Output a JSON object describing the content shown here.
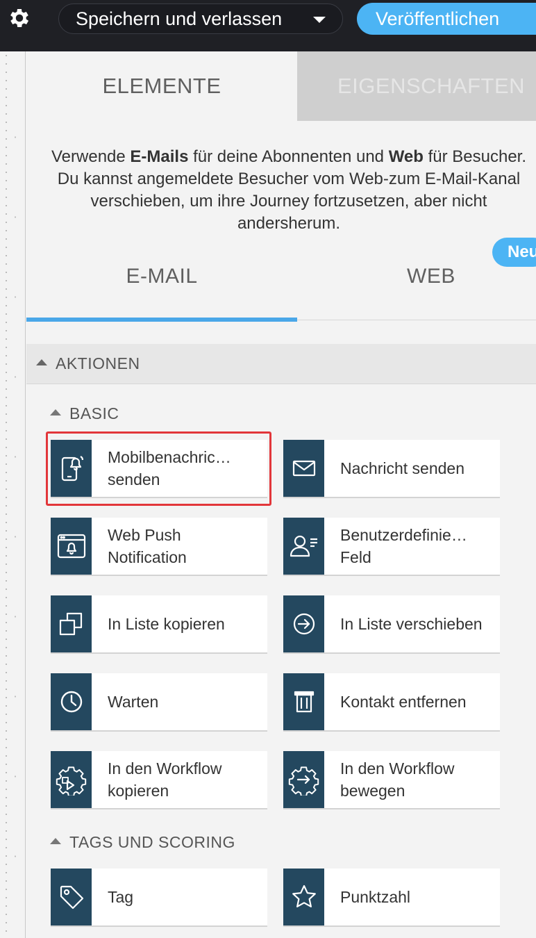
{
  "topbar": {
    "settings_icon": "gear-icon",
    "save_label": "Speichern und verlassen",
    "publish_label": "Veröffentlichen"
  },
  "panel_tabs": {
    "elements": "ELEMENTE",
    "properties": "EIGENSCHAFTEN"
  },
  "description": {
    "part1": "Verwende ",
    "bold1": "E-Mails",
    "part2": " für deine Abonnenten und ",
    "bold2": "Web",
    "part3": " für Besucher. Du kannst angemeldete Besucher vom Web-zum E-Mail-Kanal verschieben, um ihre Journey fortzusetzen, aber nicht andersherum."
  },
  "new_badge": "Neu",
  "channel_tabs": {
    "email": "E-MAIL",
    "web": "WEB",
    "active": "email"
  },
  "sections": {
    "actions": "AKTIONEN",
    "basic": "BASIC",
    "tags_scoring": "TAGS UND SCORING"
  },
  "basic_items": [
    {
      "label": "Mobilbenachric… senden",
      "icon": "mobile-notification-icon",
      "selected": true
    },
    {
      "label": "Nachricht senden",
      "icon": "envelope-icon"
    },
    {
      "label": "Web Push Notification",
      "icon": "browser-bell-icon"
    },
    {
      "label": "Benutzerdefinie… Feld",
      "icon": "user-field-icon"
    },
    {
      "label": "In Liste kopieren",
      "icon": "copy-icon"
    },
    {
      "label": "In Liste verschieben",
      "icon": "arrow-circle-icon"
    },
    {
      "label": "Warten",
      "icon": "clock-icon"
    },
    {
      "label": "Kontakt entfernen",
      "icon": "trash-icon"
    },
    {
      "label": "In den Workflow kopieren",
      "icon": "workflow-copy-icon"
    },
    {
      "label": "In den Workflow bewegen",
      "icon": "workflow-move-icon"
    }
  ],
  "tag_items": [
    {
      "label": "Tag",
      "icon": "tag-icon"
    },
    {
      "label": "Punktzahl",
      "icon": "star-icon"
    }
  ],
  "colors": {
    "topbar": "#1f2025",
    "accent": "#4cb4f4",
    "icon_tile": "#24485f",
    "highlight": "#e2363a"
  }
}
